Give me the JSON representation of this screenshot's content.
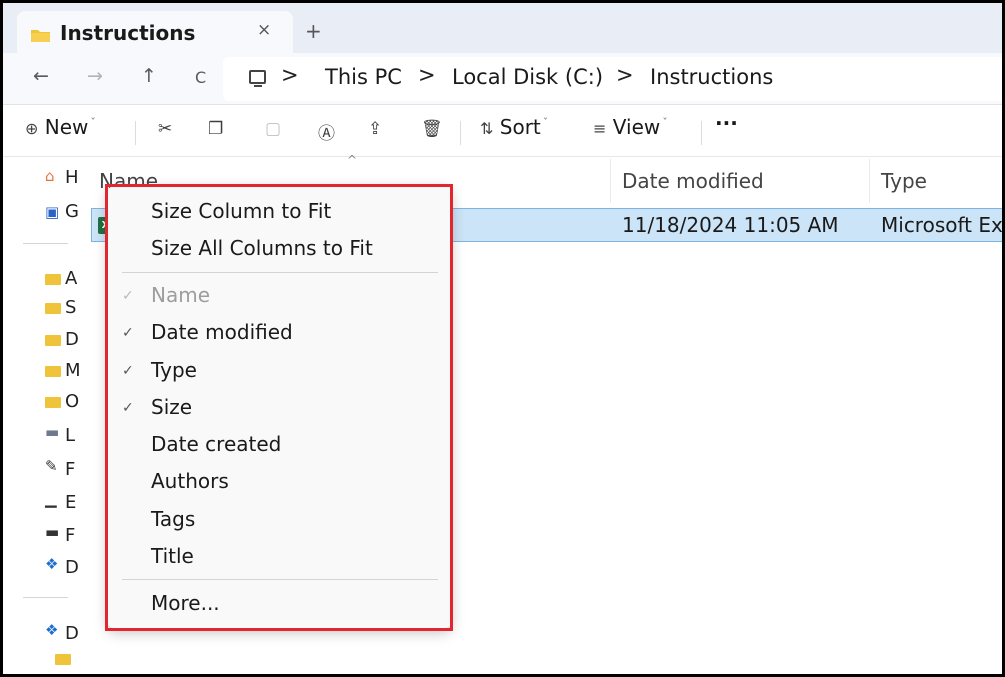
{
  "window": {
    "tab_title": "Instructions",
    "tab_close_glyph": "×",
    "new_tab_glyph": "+"
  },
  "nav": {
    "back_glyph": "←",
    "forward_glyph": "→",
    "up_glyph": "↑",
    "refresh_glyph": "C",
    "breadcrumb": [
      "This PC",
      "Local Disk (C:)",
      "Instructions"
    ],
    "separator_glyph": ">"
  },
  "commands": {
    "new_label": "New",
    "sort_label": "Sort",
    "view_label": "View",
    "more_glyph": "···",
    "new_icon": "⊕",
    "sort_icon": "⇅",
    "view_icon": "≡",
    "caret_glyph": "ˇ"
  },
  "columns": {
    "name": "Name",
    "date_modified": "Date modified",
    "type": "Type"
  },
  "file": {
    "date_modified": "11/18/2024 11:05 AM",
    "type": "Microsoft Ex",
    "icon_letter": "X"
  },
  "sidebar": {
    "truncated_chars": [
      "H",
      "G",
      "A",
      "S",
      "D",
      "M",
      "O",
      "L",
      "F",
      "E",
      "F",
      "D",
      "D"
    ]
  },
  "context_menu": {
    "top_items": [
      {
        "label": "Size Column to Fit"
      },
      {
        "label": "Size All Columns to Fit"
      }
    ],
    "column_items": [
      {
        "label": "Name",
        "checked": true,
        "disabled": true
      },
      {
        "label": "Date modified",
        "checked": true,
        "disabled": false
      },
      {
        "label": "Type",
        "checked": true,
        "disabled": false
      },
      {
        "label": "Size",
        "checked": true,
        "disabled": false
      },
      {
        "label": "Date created",
        "checked": false,
        "disabled": false
      },
      {
        "label": "Authors",
        "checked": false,
        "disabled": false
      },
      {
        "label": "Tags",
        "checked": false,
        "disabled": false
      },
      {
        "label": "Title",
        "checked": false,
        "disabled": false
      }
    ],
    "more_label": "More...",
    "check_glyph": "✓"
  },
  "colors": {
    "highlight_outline": "#e3262d",
    "selection_fill": "#cce4f7",
    "folder": "#f0c43a",
    "excel_green": "#1e7145"
  }
}
